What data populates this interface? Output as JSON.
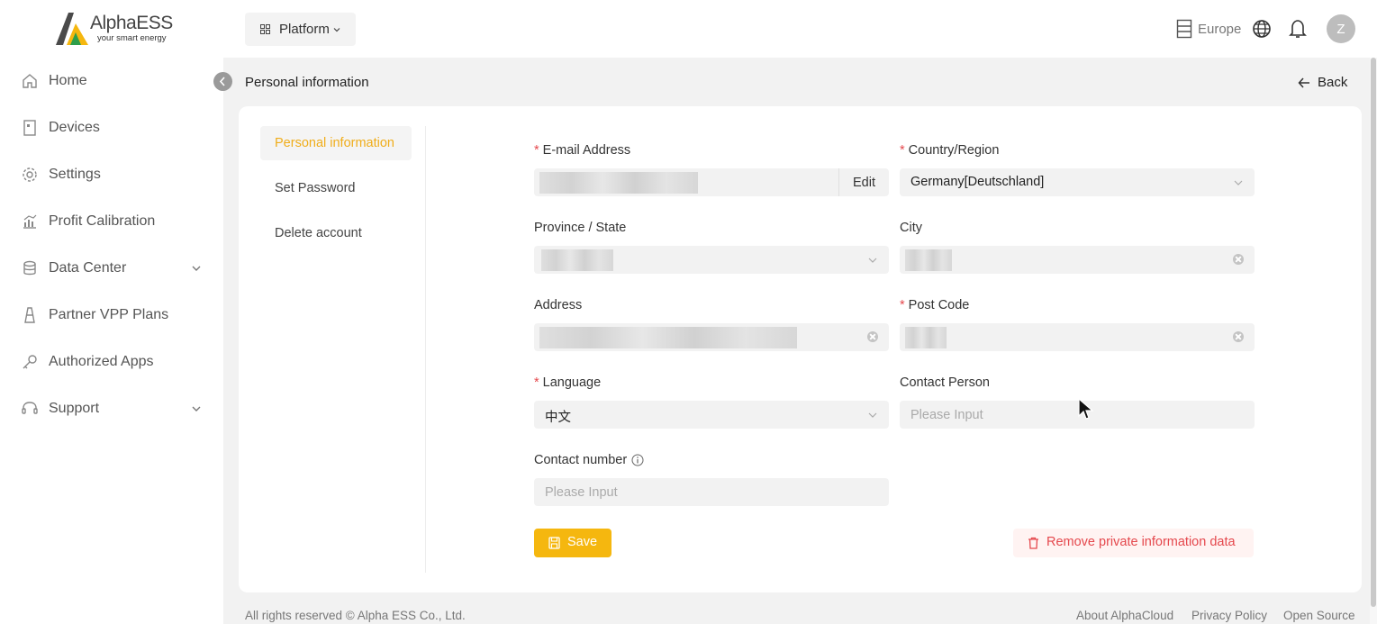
{
  "brand": {
    "name": "AlphaESS",
    "tagline": "your smart energy"
  },
  "sidebar": {
    "items": [
      {
        "label": "Home",
        "icon": "home-icon"
      },
      {
        "label": "Devices",
        "icon": "device-icon"
      },
      {
        "label": "Settings",
        "icon": "gear-icon"
      },
      {
        "label": "Profit Calibration",
        "icon": "chart-icon"
      },
      {
        "label": "Data Center",
        "icon": "database-icon",
        "expandable": true
      },
      {
        "label": "Partner VPP Plans",
        "icon": "vpp-icon"
      },
      {
        "label": "Authorized Apps",
        "icon": "key-icon"
      },
      {
        "label": "Support",
        "icon": "support-icon",
        "expandable": true
      }
    ]
  },
  "topbar": {
    "platform_label": "Platform",
    "region_label": "Europe",
    "avatar_initial": "Z"
  },
  "header": {
    "title": "Personal information",
    "back_label": "Back"
  },
  "tabs": [
    {
      "label": "Personal information",
      "active": true
    },
    {
      "label": "Set Password",
      "active": false
    },
    {
      "label": "Delete account",
      "active": false
    }
  ],
  "form": {
    "email": {
      "label": "E-mail Address",
      "required": true,
      "value": "",
      "edit_label": "Edit"
    },
    "country": {
      "label": "Country/Region",
      "required": true,
      "value": "Germany[Deutschland]"
    },
    "province": {
      "label": "Province / State",
      "required": false,
      "value": ""
    },
    "city": {
      "label": "City",
      "required": false,
      "value": ""
    },
    "address": {
      "label": "Address",
      "required": false,
      "value": ""
    },
    "postcode": {
      "label": "Post Code",
      "required": true,
      "value": ""
    },
    "language": {
      "label": "Language",
      "required": true,
      "value": "中文"
    },
    "contact_person": {
      "label": "Contact Person",
      "required": false,
      "placeholder": "Please Input"
    },
    "contact_number": {
      "label": "Contact number",
      "required": false,
      "placeholder": "Please Input"
    },
    "save_label": "Save",
    "remove_label": "Remove private information data"
  },
  "footer": {
    "copyright": "All rights reserved © Alpha ESS Co., Ltd.",
    "links": [
      "About AlphaCloud",
      "Privacy Policy",
      "Open Source"
    ]
  },
  "colors": {
    "accent": "#f5b70f",
    "danger": "#e5484d",
    "active_tab_text": "#f0ad1a"
  }
}
